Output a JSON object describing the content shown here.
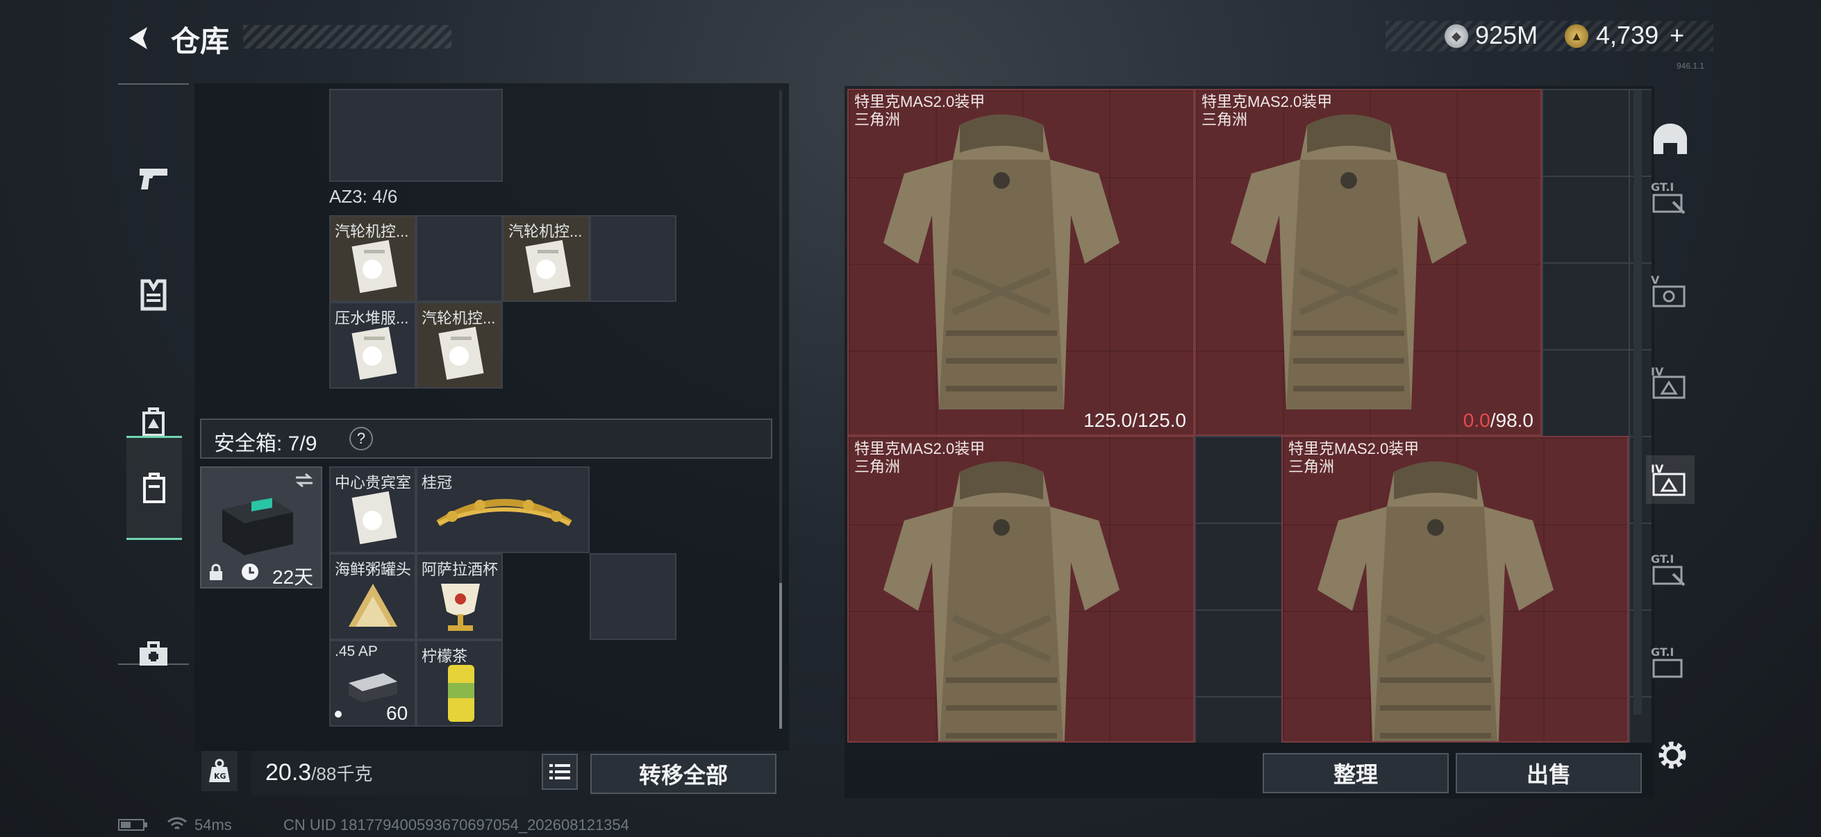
{
  "header": {
    "title": "仓库",
    "back_label": "back"
  },
  "currency": {
    "silver_value": "925M",
    "gold_value": "4,739",
    "add_label": "+",
    "silver_icon": "silver-coin-icon",
    "gold_icon": "gold-coin-icon"
  },
  "version": "946.1.1",
  "left_nav": {
    "items": [
      {
        "name": "weapons",
        "icon": "pistol-icon",
        "active": false
      },
      {
        "name": "vest",
        "icon": "vest-icon",
        "active": false
      },
      {
        "name": "backpack",
        "icon": "backpack-icon",
        "active": false
      },
      {
        "name": "safebox",
        "icon": "case-icon",
        "active": true
      },
      {
        "name": "medkit",
        "icon": "medkit-icon",
        "active": false
      }
    ]
  },
  "backpack": {
    "az3_label": "AZ3: 4/6",
    "az3_items": [
      "汽轮机控...",
      "汽轮机控...",
      "压水堆服...",
      "汽轮机控..."
    ],
    "safe_label": "安全箱: 7/9",
    "safe_help": "?",
    "safe_days": "22天",
    "safe_items": [
      {
        "name": "中心贵宾室"
      },
      {
        "name": "桂冠"
      },
      {
        "name": "海鲜粥罐头"
      },
      {
        "name": "阿萨拉酒杯"
      },
      {
        "name": ".45 AP",
        "count": "60"
      },
      {
        "name": "柠檬茶"
      }
    ]
  },
  "weight": {
    "value": "20.3",
    "max": "/88千克"
  },
  "buttons": {
    "transfer_all": "转移全部",
    "sort": "整理",
    "sell": "出售"
  },
  "stash_items": [
    {
      "name": "特里克MAS2.0装甲",
      "sub": "三角洲",
      "dur_cur": "125.0",
      "dur_max": "/125.0",
      "damaged": false
    },
    {
      "name": "特里克MAS2.0装甲",
      "sub": "三角洲",
      "dur_cur": "0.0",
      "dur_max": "/98.0",
      "damaged": true
    },
    {
      "name": "特里克MAS2.0装甲",
      "sub": "三角洲",
      "dur_cur": "",
      "dur_max": "",
      "damaged": false
    },
    {
      "name": "特里克MAS2.0装甲",
      "sub": "三角洲",
      "dur_cur": "",
      "dur_max": "",
      "damaged": false
    }
  ],
  "right_filters": [
    "helmet-icon",
    "gti-icon",
    "v-grade-icon",
    "iv-grade-icon",
    "iv-grade-active-icon",
    "gti-icon",
    "gti-icon"
  ],
  "status": {
    "ping": "54ms",
    "uid": "CN UID 18177940059367069705​4_202608121354"
  },
  "colors": {
    "accent": "#6fd6ae",
    "armor_bg": "#5f2a2d",
    "damage_red": "#e84b4b"
  }
}
